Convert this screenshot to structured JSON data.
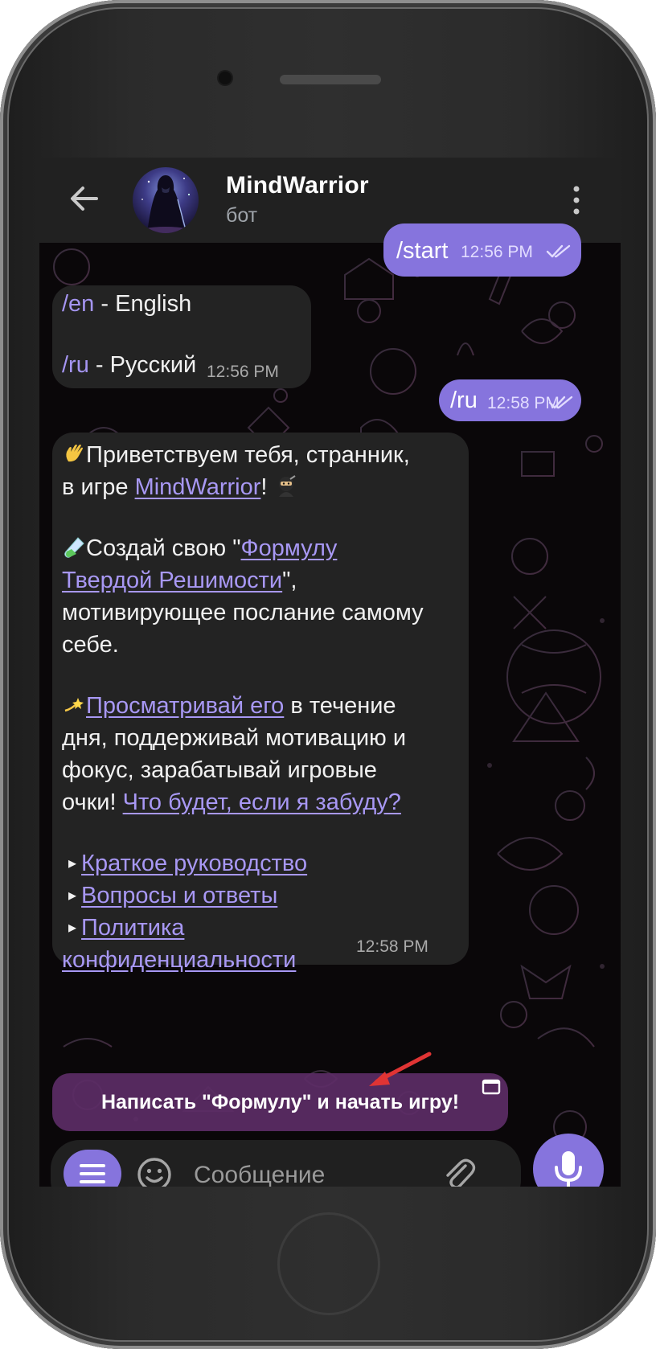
{
  "header": {
    "title": "MindWarrior",
    "subtitle": "бот"
  },
  "messages": {
    "start": {
      "text": "/start",
      "time": "12:56 PM"
    },
    "lang": {
      "en_cmd": "/en",
      "en_label": " - English",
      "ru_cmd": "/ru",
      "ru_label": " - Русский",
      "time": "12:56 PM"
    },
    "ru": {
      "text": "/ru",
      "time": "12:58 PM"
    },
    "welcome": {
      "greet": "Приветствуем тебя, странник,",
      "greet2": "в игре ",
      "game_link": "MindWarrior",
      "excl": "!",
      "create_pre": "Создай свою \"",
      "formula_link_1": "Формулу ",
      "formula_link_2": "Твердой Решимости",
      "create_post": "\",",
      "create_line3": "мотивирующее послание самому",
      "create_line4": "себе.",
      "view_link": "Просматривай его",
      "view_post": " в течение",
      "view_line2": "дня, поддерживай мотивацию и",
      "view_line3": "фокус, зарабатывай игровые",
      "view_line4": "очки! ",
      "forget_link": "Что будет, если я забуду?",
      "bullet": "▸",
      "guide_link": "Краткое руководство",
      "faq_link": "Вопросы и ответы",
      "privacy_link_1": "Политика ",
      "privacy_link_2": "конфиденциальности",
      "time": "12:58 PM"
    }
  },
  "inline_button": {
    "label": "Написать \"Формулу\" и начать игру!"
  },
  "input": {
    "placeholder": "Сообщение"
  },
  "colors": {
    "accent": "#8674dd",
    "link": "#a898f4",
    "bubble_in": "#232323",
    "header": "#212121"
  }
}
